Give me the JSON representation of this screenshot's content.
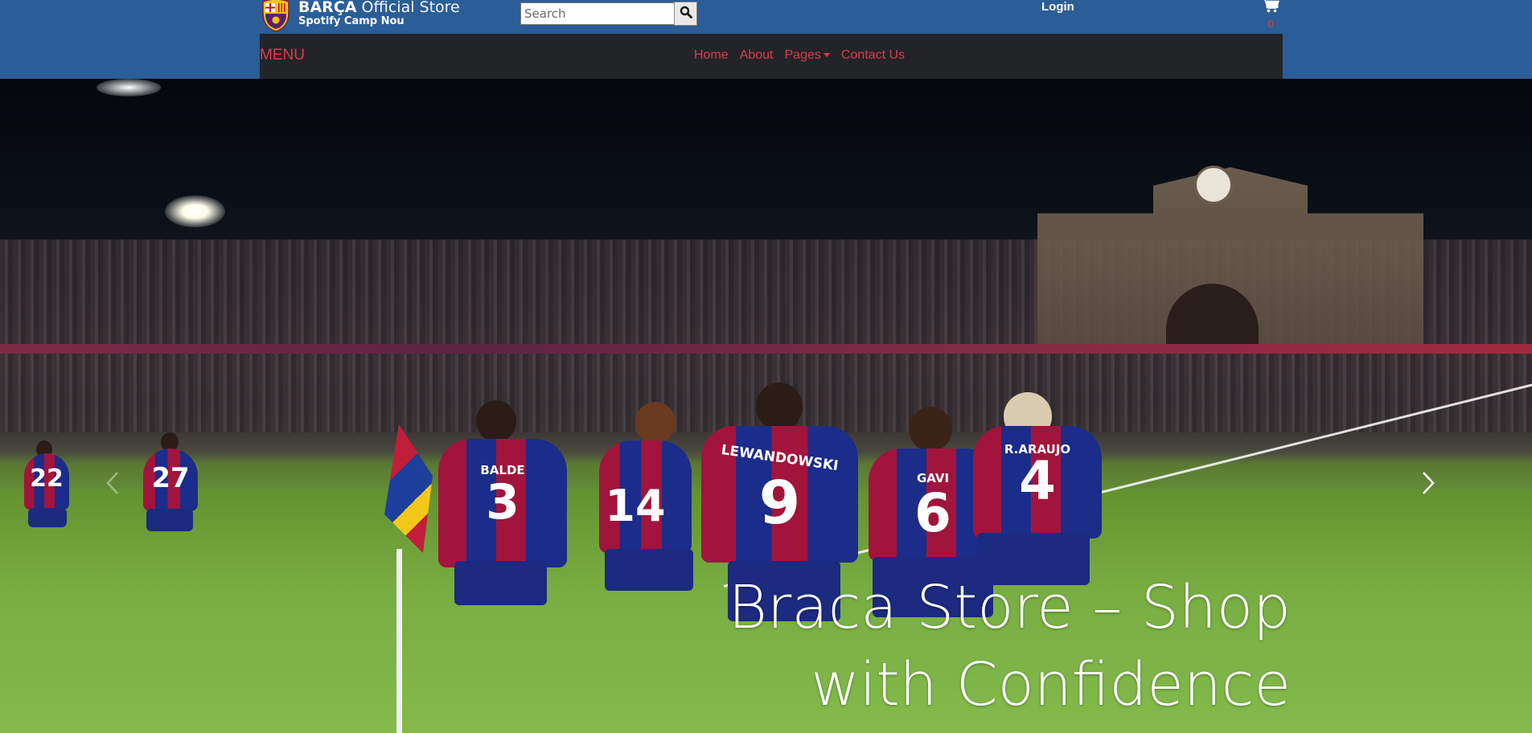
{
  "header": {
    "brand_name": "BARÇA",
    "brand_suffix": "Official Store",
    "brand_sub": "Spotify Camp Nou",
    "search_placeholder": "Search",
    "login_label": "Login",
    "cart_count": "0"
  },
  "nav": {
    "menu_label": "MENU",
    "links": [
      "Home",
      "About",
      "Pages",
      "Contact Us"
    ]
  },
  "hero": {
    "caption_line1": "Braca Store – Shop",
    "caption_line2": "with Confidence",
    "players": [
      {
        "name": "BALDE",
        "number": "3"
      },
      {
        "name": "LEWANDOWSKI",
        "number": "9"
      },
      {
        "name": "GAVI",
        "number": "6"
      },
      {
        "name": "R.ARAUJO",
        "number": "4"
      },
      {
        "name": "",
        "number": "14"
      },
      {
        "name": "",
        "number": "22"
      },
      {
        "name": "",
        "number": "27"
      }
    ]
  },
  "icons": {
    "search": "search-icon",
    "cart": "cart-icon",
    "next": "chevron-right-icon",
    "prev": "chevron-left-icon",
    "logo": "fc-barcelona-crest"
  },
  "colors": {
    "header_bg": "#2b5d96",
    "navbar_bg": "#222428",
    "accent": "#e0384e"
  }
}
